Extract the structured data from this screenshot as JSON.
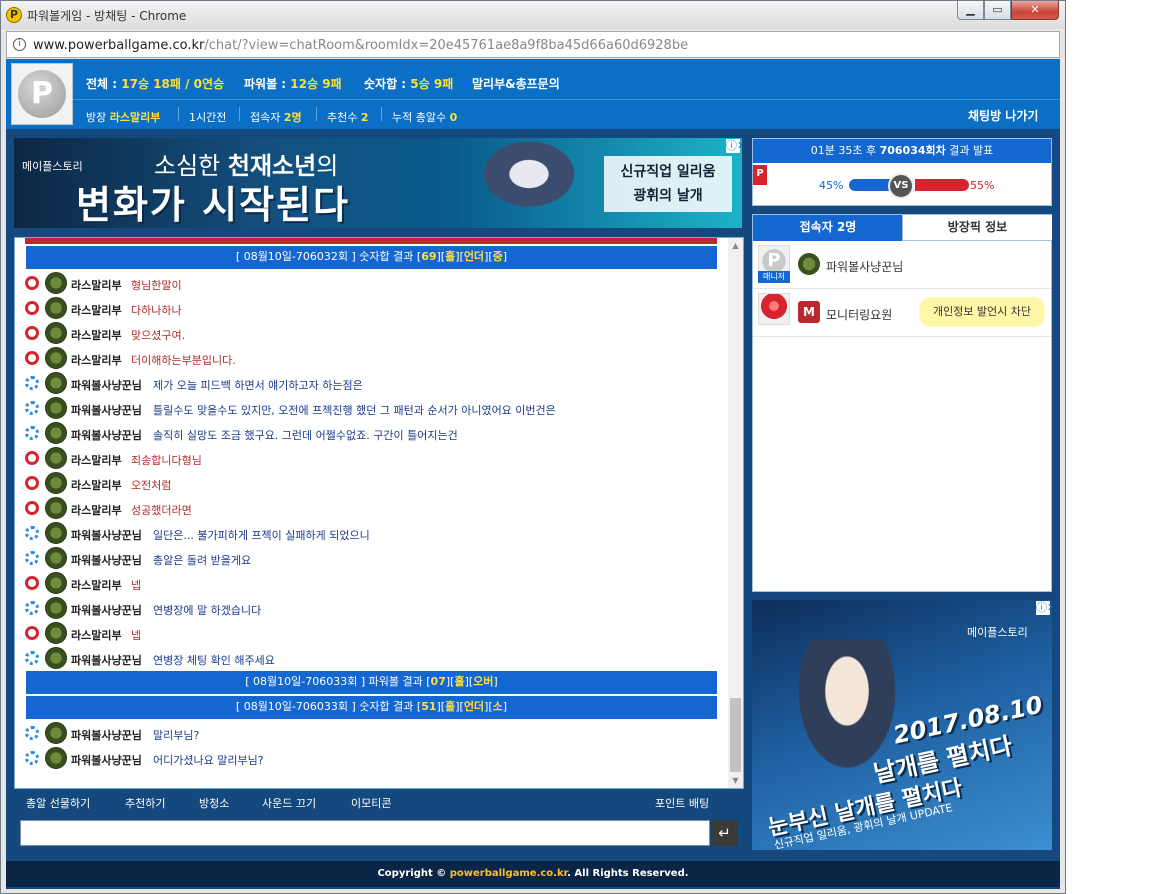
{
  "window": {
    "title": "파워볼게임 - 방채팅 - Chrome",
    "min": "▁",
    "max": "▭",
    "close": "✕"
  },
  "address": {
    "host": "www.powerballgame.co.kr",
    "path": "/chat/?view=chatRoom&roomIdx=20e45761ae8a9f8ba45d66a60d6928be"
  },
  "header": {
    "stats": [
      {
        "label": "전체 : ",
        "value": "17승 18패 / 0연승"
      },
      {
        "label": "파워볼 : ",
        "value": "12승 9패"
      },
      {
        "label": "숫자합 : ",
        "value": "5승 9패"
      }
    ],
    "extra_link": "말리부&총프문의",
    "room_owner_label": "방장",
    "room_owner": "라스말리부",
    "time_ago": "1시간전",
    "users_label": "접속자",
    "users_value": "2명",
    "recommend_label": "추천수",
    "recommend_value": "2",
    "gifts_label": "누적 총알수",
    "gifts_value": "0",
    "leave": "채팅방 나가기"
  },
  "ad_top": {
    "brand": "메이플스토리",
    "line1a": "소심한 ",
    "line1b": "천재소년",
    "line1c": "의",
    "line2": "변화가 시작된다",
    "box1": "신규직업 일리움",
    "box2": "광휘의 날개",
    "close": "ⓘ✕"
  },
  "chat": {
    "system1": {
      "pre": "[ 08월10일-706032회 ] 숫자합 결과 [",
      "val1": "69",
      "mid1": "][",
      "val2": "홀",
      "mid2": "][",
      "val3": "언더",
      "mid3": "][",
      "val4": "중",
      "post": "]"
    },
    "messages_a": [
      {
        "nick": "라스말리부",
        "text": "형님한말이",
        "color": "red"
      },
      {
        "nick": "라스말리부",
        "text": "다하나하나",
        "color": "red"
      },
      {
        "nick": "라스말리부",
        "text": "맞으셨구여.",
        "color": "red"
      },
      {
        "nick": "라스말리부",
        "text": "더이해하는부분입니다.",
        "color": "red"
      },
      {
        "nick": "파워볼사냥꾼님",
        "text": "제가 오늘 피드백 하면서 얘기하고자 하는점은",
        "color": "blue"
      },
      {
        "nick": "파워볼사냥꾼님",
        "text": "틀릴수도 맞을수도 있지만, 오전에 프젝진행 했던 그 패턴과 순서가 아니였어요 이번건은",
        "color": "blue"
      },
      {
        "nick": "파워볼사냥꾼님",
        "text": "솔직히 실망도 조금 했구요. 그런데 어쩔수없죠. 구간이 틀어지는건",
        "color": "blue"
      },
      {
        "nick": "라스말리부",
        "text": "죄송합니다형님",
        "color": "red"
      },
      {
        "nick": "라스말리부",
        "text": "오전처럼",
        "color": "red"
      },
      {
        "nick": "라스말리부",
        "text": "성공했더라면",
        "color": "red"
      },
      {
        "nick": "파워볼사냥꾼님",
        "text": "일단은... 불가피하게 프젝이 실패하게 되었으니",
        "color": "blue"
      },
      {
        "nick": "파워볼사냥꾼님",
        "text": "총알은 돌려 받을게요",
        "color": "blue"
      },
      {
        "nick": "라스말리부",
        "text": "넵",
        "color": "red"
      },
      {
        "nick": "파워볼사냥꾼님",
        "text": "연병장에 말 하겠습니다",
        "color": "blue"
      },
      {
        "nick": "라스말리부",
        "text": "넵",
        "color": "red"
      },
      {
        "nick": "파워볼사냥꾼님",
        "text": "연병장 체팅 확인 해주세요",
        "color": "blue"
      }
    ],
    "system2": {
      "pre": "[ 08월10일-706033회 ] 파워볼 결과 [",
      "val1": "07",
      "mid1": "][",
      "val2": "홀",
      "mid2": "][",
      "val3": "오버",
      "post": "]"
    },
    "system3": {
      "pre": "[ 08월10일-706033회 ] 숫자합 결과 [",
      "val1": "51",
      "mid1": "][",
      "val2": "홀",
      "mid2": "][",
      "val3": "언더",
      "mid3": "][",
      "val4": "소",
      "post": "]"
    },
    "messages_b": [
      {
        "nick": "파워볼사냥꾼님",
        "text": "말리부님?",
        "color": "blue"
      },
      {
        "nick": "파워볼사냥꾼님",
        "text": "어디가셨나요 말리부님?",
        "color": "blue"
      }
    ]
  },
  "chat_menu": {
    "gift": "총알 선물하기",
    "recommend": "추천하기",
    "listen": "방청소",
    "sound": "사운드 끄기",
    "emoticon": "이모티콘",
    "point": "포인트 배팅"
  },
  "input": {
    "placeholder": "",
    "send": "↵"
  },
  "result": {
    "time": "01분 35초 후 ",
    "round": "706034회차",
    "suffix": " 결과 발표",
    "flag": "P",
    "left_pct": "45%",
    "right_pct": "55%",
    "vs": "VS",
    "left_fraction": 0.45,
    "right_fraction": 0.55
  },
  "users": {
    "tab_users": "접속자 2명",
    "tab_manager": "방장픽 정보",
    "list": [
      {
        "name": "파워볼사냥꾼님",
        "tag": "매니저"
      },
      {
        "name": "모니터링요원",
        "badge": "M"
      }
    ],
    "bubble": "개인정보 발언시 차단"
  },
  "ad_side": {
    "brand": "메이플스토리",
    "date": "2017.08.10",
    "slogan": "날개를 펼치다",
    "big": "눈부신 날개를 펼치다",
    "small": "신규직업 일리움, 광휘의 날개 UPDATE",
    "close": "ⓘ✕"
  },
  "footer": {
    "pre": "Copyright © ",
    "brand": "powerballgame.co.kr",
    "post": ". All Rights Reserved."
  },
  "colors": {
    "accent": "#0b6fc6",
    "highlight": "#ffe03a",
    "red": "#c8242b"
  }
}
